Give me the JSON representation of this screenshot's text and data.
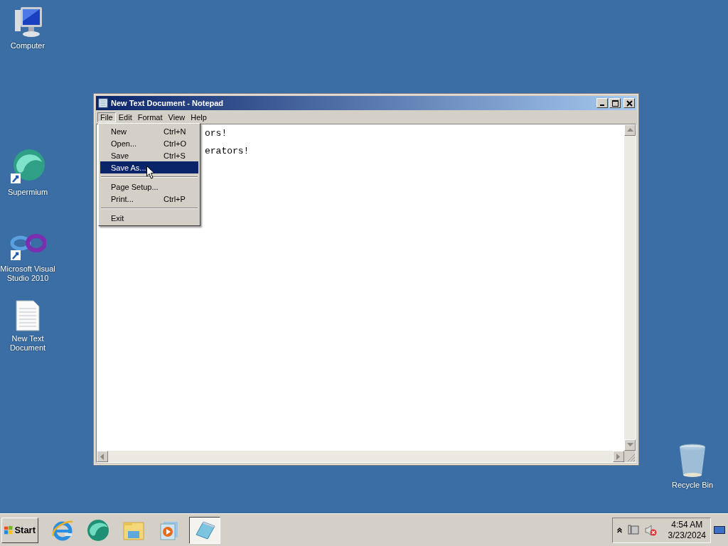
{
  "desktop_icons": [
    {
      "label": "Computer",
      "kind": "computer"
    },
    {
      "label": "Supermium",
      "kind": "browser"
    },
    {
      "label": "Microsoft Visual Studio 2010",
      "kind": "studio"
    },
    {
      "label": "New Text Document",
      "kind": "document"
    },
    {
      "label": "Recycle Bin",
      "kind": "bin"
    }
  ],
  "window": {
    "title": "New Text Document - Notepad",
    "menu_bar": [
      {
        "label": "File",
        "selected": true
      },
      {
        "label": "Edit",
        "selected": false
      },
      {
        "label": "Format",
        "selected": false
      },
      {
        "label": "View",
        "selected": false
      },
      {
        "label": "Help",
        "selected": false
      }
    ],
    "text_lines": [
      "ors!",
      "erators!"
    ],
    "file_menu": [
      {
        "kind": "item",
        "label": "New",
        "shortcut": "Ctrl+N",
        "selected": false
      },
      {
        "kind": "item",
        "label": "Open...",
        "shortcut": "Ctrl+O",
        "selected": false
      },
      {
        "kind": "item",
        "label": "Save",
        "shortcut": "Ctrl+S",
        "selected": false
      },
      {
        "kind": "item",
        "label": "Save As...",
        "selected": true
      },
      {
        "kind": "separator"
      },
      {
        "kind": "item",
        "label": "Page Setup...",
        "selected": false
      },
      {
        "kind": "item",
        "label": "Print...",
        "shortcut": "Ctrl+P",
        "selected": false
      },
      {
        "kind": "separator"
      },
      {
        "kind": "item",
        "label": "Exit",
        "selected": false
      }
    ]
  },
  "taskbar": {
    "start_label": "Start",
    "apps": [
      {
        "kind": "ie",
        "selected": false
      },
      {
        "kind": "browser",
        "selected": false
      },
      {
        "kind": "folder",
        "selected": false
      },
      {
        "kind": "media",
        "selected": false
      },
      {
        "kind": "notepad",
        "selected": true
      }
    ],
    "time": "4:54 AM",
    "date": "3/23/2024"
  }
}
